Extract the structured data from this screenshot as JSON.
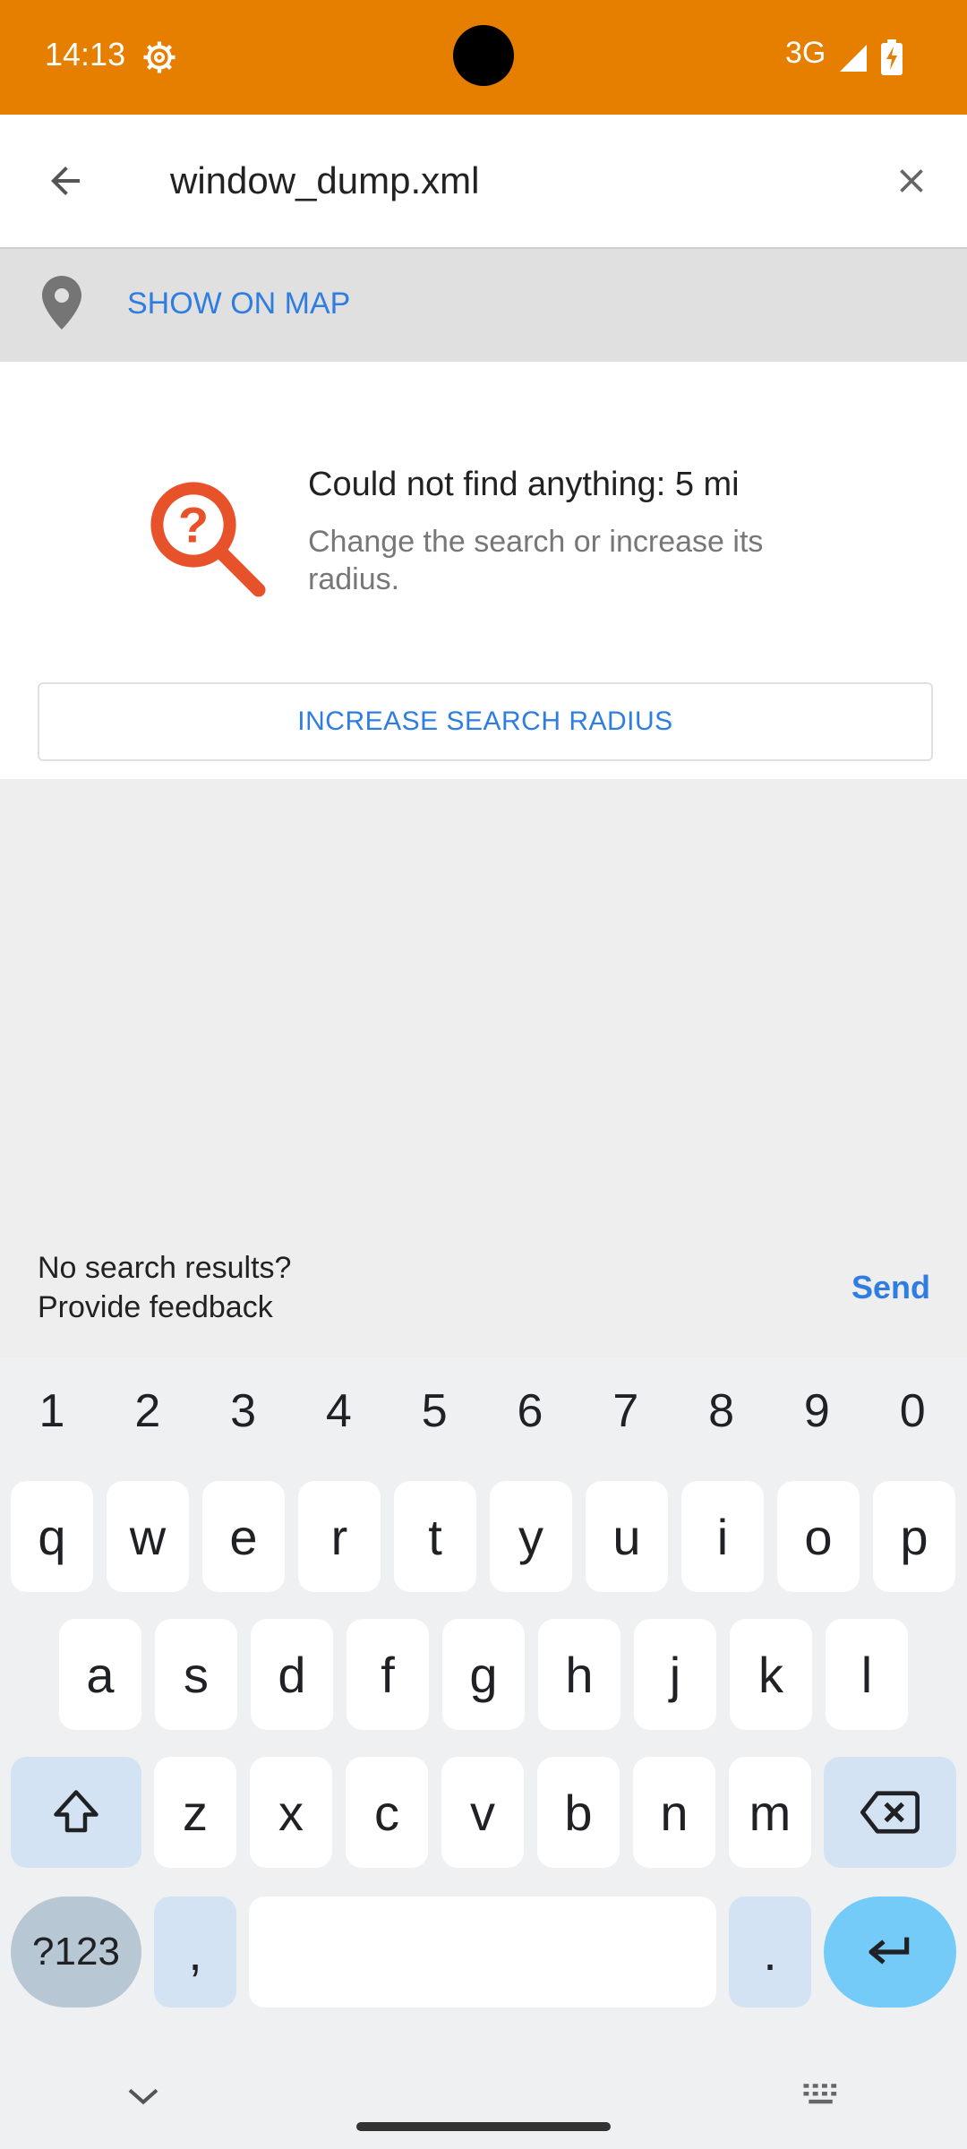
{
  "status_bar": {
    "time": "14:13",
    "network": "3G",
    "icons": [
      "gear-icon",
      "signal-icon",
      "battery-charging-icon"
    ],
    "color": "#e67e00"
  },
  "toolbar": {
    "search_value": "window_dump.xml",
    "back_icon": "arrow-left-icon",
    "clear_icon": "close-icon"
  },
  "map_bar": {
    "label": "SHOW ON MAP",
    "icon": "map-pin-icon"
  },
  "empty_result": {
    "icon": "search-question-icon",
    "title": "Could not find anything: 5 mi",
    "description": "Change the search or increase its radius.",
    "button_label": "INCREASE SEARCH RADIUS"
  },
  "feedback": {
    "line1": "No search results?",
    "line2": "Provide feedback",
    "send_label": "Send"
  },
  "keyboard": {
    "numbers": [
      "1",
      "2",
      "3",
      "4",
      "5",
      "6",
      "7",
      "8",
      "9",
      "0"
    ],
    "row1": [
      "q",
      "w",
      "e",
      "r",
      "t",
      "y",
      "u",
      "i",
      "o",
      "p"
    ],
    "row2": [
      "a",
      "s",
      "d",
      "f",
      "g",
      "h",
      "j",
      "k",
      "l"
    ],
    "row3": [
      "z",
      "x",
      "c",
      "v",
      "b",
      "n",
      "m"
    ],
    "sym_label": "?123",
    "comma": ",",
    "period": "."
  },
  "colors": {
    "accent": "#2f7de1",
    "question_icon": "#e8522a"
  }
}
